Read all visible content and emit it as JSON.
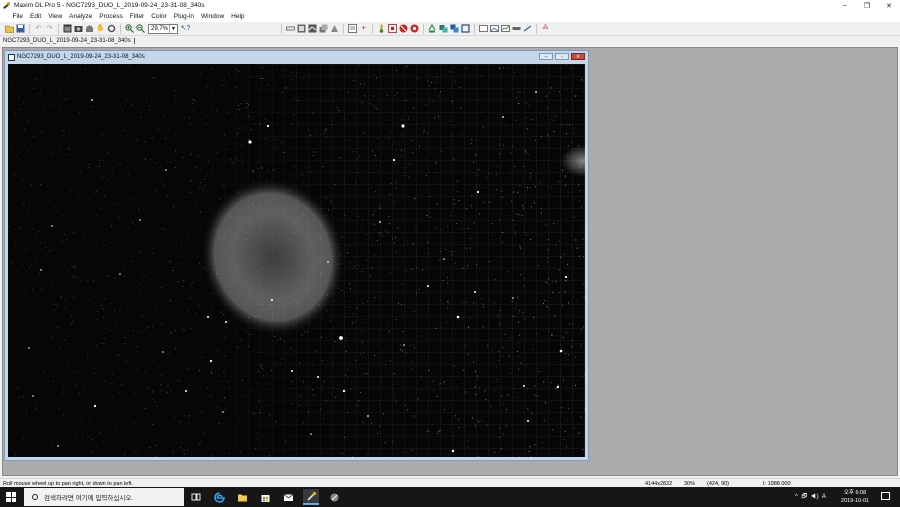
{
  "window": {
    "title": "Maxim DL Pro 5 - NGC7293_DUO_L_2019-09-24_23-31-08_340s",
    "minimize": "–",
    "maximize": "❐",
    "close": "✕"
  },
  "menu": [
    "File",
    "Edit",
    "View",
    "Analyze",
    "Process",
    "Filter",
    "Color",
    "Plug-in",
    "Window",
    "Help"
  ],
  "toolbar": {
    "zoom": "29.7%"
  },
  "tab": {
    "label": "NGC7293_DUO_L_2019-09-24_23-31-08_340s"
  },
  "image_window": {
    "title": "NGC7293_DUO_L_2019-09-24_23-31-08_340s"
  },
  "status": {
    "hint": "Roll mouse wheel up to pan right, or down to pan left.",
    "dimensions": "4144x2822",
    "zoom": "30%",
    "cursor": "(424, 90)",
    "intensity": "I: 1988.000"
  },
  "taskbar": {
    "search_placeholder": "검색하려면 여기에 입력하십시오.",
    "time": "오후 6:08",
    "date": "2019-10-01",
    "ime": "A"
  },
  "colors": {
    "mdi_background": "#ababab",
    "image_window_frame": "#c4d7ea",
    "taskbar": "#161616"
  }
}
